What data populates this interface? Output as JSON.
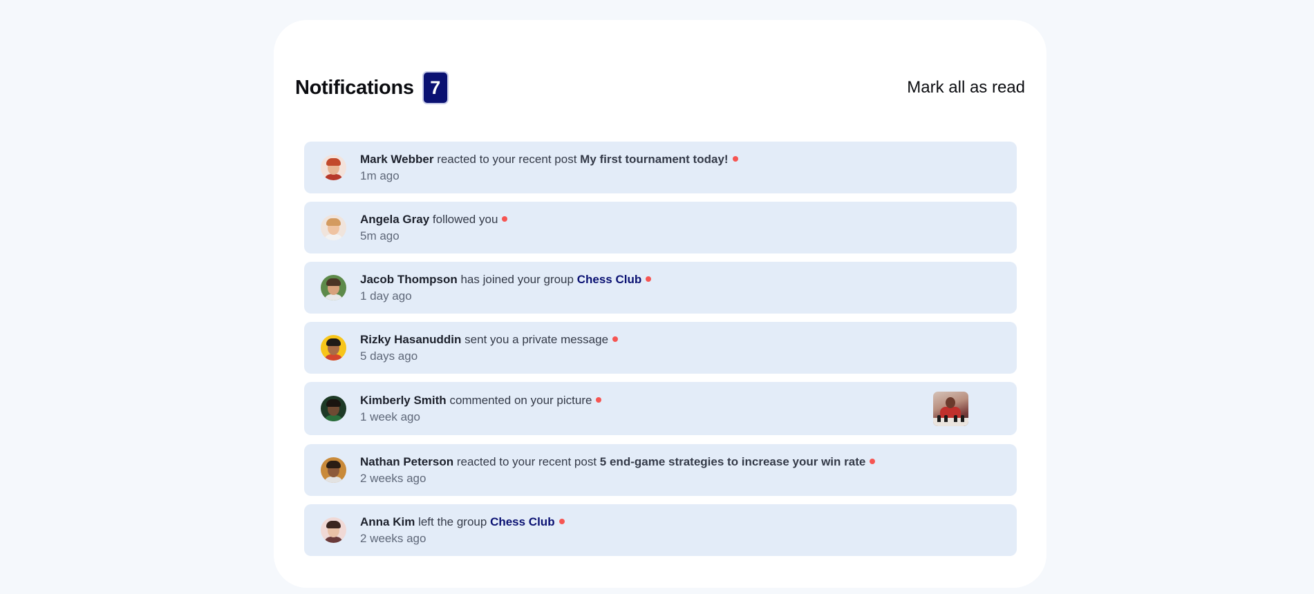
{
  "header": {
    "title": "Notifications",
    "count": "7",
    "mark_all_label": "Mark all as read"
  },
  "notifications": [
    {
      "name": "Mark Webber",
      "action": "reacted to your recent post",
      "post": "My first tournament today!",
      "group": "",
      "time": "1m ago",
      "unread": true,
      "avatar": {
        "bg": "#f3e3dc",
        "hair": "#c2492b",
        "skin": "#e8b592",
        "body": "#b6392a"
      }
    },
    {
      "name": "Angela Gray",
      "action": "followed you",
      "post": "",
      "group": "",
      "time": "5m ago",
      "unread": true,
      "avatar": {
        "bg": "#f0e4dc",
        "hair": "#d39a5f",
        "skin": "#efc3a1",
        "body": "#f2f2f2"
      }
    },
    {
      "name": "Jacob Thompson",
      "action": "has joined your group",
      "post": "",
      "group": "Chess Club",
      "time": "1 day ago",
      "unread": true,
      "avatar": {
        "bg": "#5d8a4a",
        "hair": "#4a3425",
        "skin": "#d7a27c",
        "body": "#e8e8e8"
      }
    },
    {
      "name": "Rizky Hasanuddin",
      "action": "sent you a private message",
      "post": "",
      "group": "",
      "time": "5 days ago",
      "unread": true,
      "avatar": {
        "bg": "#f7c51a",
        "hair": "#1f1a17",
        "skin": "#a86c47",
        "body": "#d3452d"
      }
    },
    {
      "name": "Kimberly Smith",
      "action": "commented on your picture",
      "post": "",
      "group": "",
      "time": "1 week ago",
      "unread": true,
      "avatar": {
        "bg": "#1e3a26",
        "hair": "#1a1410",
        "skin": "#6f4a33",
        "body": "#2b6f3c"
      }
    },
    {
      "name": "Nathan Peterson",
      "action": "reacted to your recent post",
      "post": "5 end-game strategies to increase your win rate",
      "group": "",
      "time": "2 weeks ago",
      "unread": true,
      "avatar": {
        "bg": "#c98a3a",
        "hair": "#2a1d14",
        "skin": "#8c5a3b",
        "body": "#e2e2e2"
      }
    },
    {
      "name": "Anna Kim",
      "action": "left the group",
      "post": "",
      "group": "Chess Club",
      "time": "2 weeks ago",
      "unread": true,
      "avatar": {
        "bg": "#f0d9d6",
        "hair": "#3a2520",
        "skin": "#e9c1a7",
        "body": "#6a3a3a"
      }
    }
  ],
  "colors": {
    "badge": "#0a1172",
    "unread_dot": "#f65552",
    "item_bg": "#e3ecf8"
  }
}
